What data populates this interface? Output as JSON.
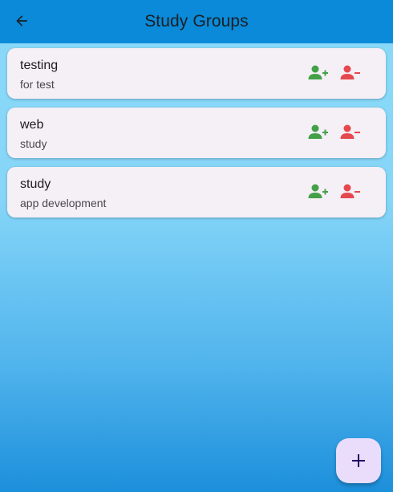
{
  "appbar": {
    "title": "Study Groups",
    "back_icon": "arrow-left-icon"
  },
  "groups": [
    {
      "name": "testing",
      "description": "for test",
      "join_icon": "person-add-icon",
      "leave_icon": "person-remove-icon"
    },
    {
      "name": "web",
      "description": "study",
      "join_icon": "person-add-icon",
      "leave_icon": "person-remove-icon"
    },
    {
      "name": "study",
      "description": "app development",
      "join_icon": "person-add-icon",
      "leave_icon": "person-remove-icon"
    }
  ],
  "fab": {
    "icon": "plus-icon"
  },
  "colors": {
    "appbar": "#0a8ad8",
    "card": "#f5eff6",
    "join": "#43a047",
    "leave": "#e5484d",
    "fab": "#eaddfc"
  }
}
